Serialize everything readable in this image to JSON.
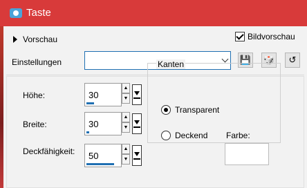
{
  "window": {
    "title": "Taste",
    "app_icon": "camera-icon"
  },
  "preview": {
    "label": "Vorschau",
    "bild_label": "Bildvorschau",
    "bild_checked": true
  },
  "settings": {
    "label": "Einstellungen",
    "combo_value": "",
    "buttons": [
      {
        "icon": "save-icon"
      },
      {
        "icon": "dice-icon"
      },
      {
        "icon": "reset-icon"
      }
    ]
  },
  "fields": [
    {
      "label": "Höhe:",
      "value": "30",
      "fraction": 0.14
    },
    {
      "label": "Breite:",
      "value": "30",
      "fraction": 0.05
    },
    {
      "label": "Deckfähigkeit:",
      "value": "50",
      "fraction": 0.5
    }
  ],
  "kanten": {
    "title": "Kanten",
    "transparent": "Transparent",
    "deckend": "Deckend",
    "farbe": "Farbe:",
    "selected": "Transparent"
  },
  "colors": {
    "titlebar": "#d83a3a",
    "accent": "#1f6fb2"
  }
}
